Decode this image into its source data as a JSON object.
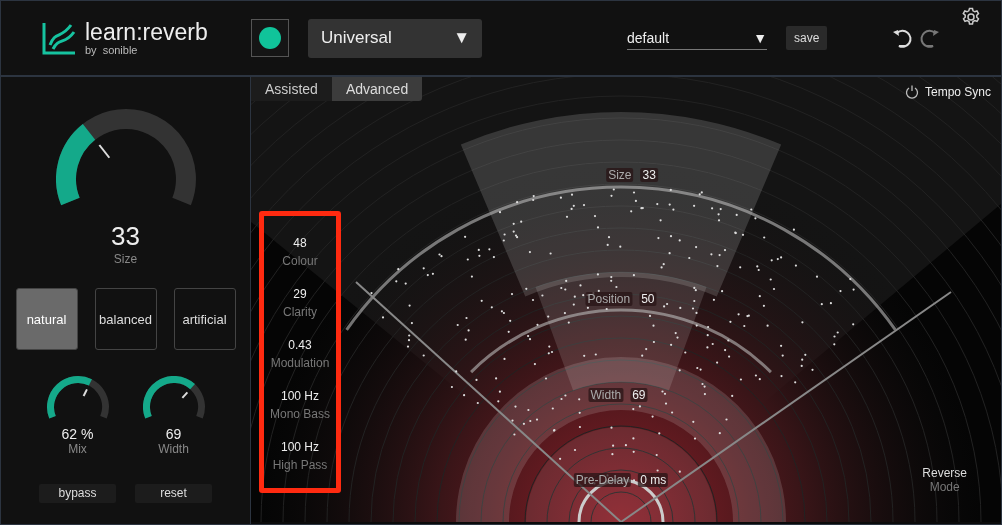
{
  "header": {
    "logo_title": "learn:reverb",
    "logo_by": "by",
    "logo_brand": "sonible",
    "profile": {
      "selected_glyph": "▼",
      "label": "Universal"
    },
    "preset": {
      "label": "default",
      "arrow": "▼"
    },
    "save": "save"
  },
  "left_panel": {
    "main_knob": {
      "value": "33",
      "label": "Size",
      "level": 0.33
    },
    "styles": [
      {
        "label": "natural",
        "selected": true
      },
      {
        "label": "balanced",
        "selected": false
      },
      {
        "label": "artificial",
        "selected": false
      }
    ],
    "knobs": [
      {
        "value": "62 %",
        "label": "Mix",
        "level": 0.62
      },
      {
        "value": "69",
        "label": "Width",
        "level": 0.69
      }
    ],
    "buttons": [
      "bypass",
      "reset"
    ]
  },
  "tabs": [
    {
      "label": "Assisted",
      "selected": false
    },
    {
      "label": "Advanced",
      "selected": true
    }
  ],
  "tempo_sync": "Tempo Sync",
  "params": [
    {
      "value": "48",
      "label": "Colour"
    },
    {
      "value": "29",
      "label": "Clarity"
    },
    {
      "value": "0.43",
      "label": "Modulation"
    },
    {
      "value": "100 Hz",
      "label": "Mono Bass"
    },
    {
      "value": "100 Hz",
      "label": "High Pass"
    }
  ],
  "space": [
    {
      "label": "Size",
      "value": "33"
    },
    {
      "label": "Position",
      "value": "50"
    },
    {
      "label": "Width",
      "value": "69"
    },
    {
      "label": "Pre-Delay",
      "value": "0 ms"
    }
  ],
  "reverse": {
    "label": "Reverse",
    "sub": "Mode"
  }
}
